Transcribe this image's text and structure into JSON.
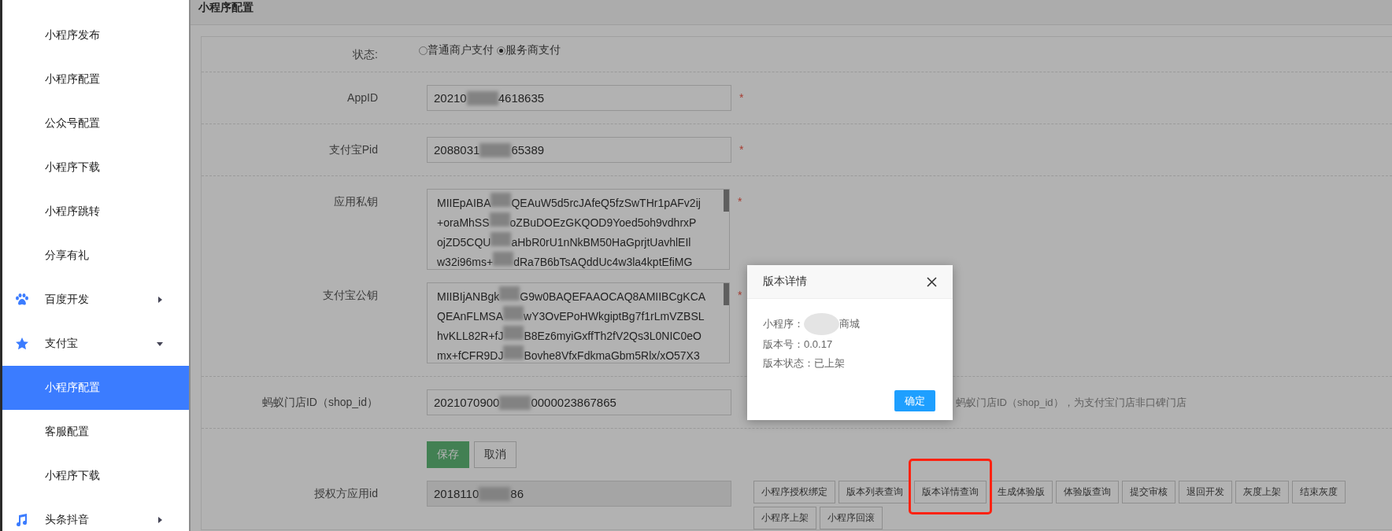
{
  "sidebar": {
    "items": [
      {
        "label": "小程序发布",
        "kind": "sub",
        "selected": false
      },
      {
        "label": "小程序配置",
        "kind": "sub",
        "selected": false
      },
      {
        "label": "公众号配置",
        "kind": "sub",
        "selected": false
      },
      {
        "label": "小程序下载",
        "kind": "sub",
        "selected": false
      },
      {
        "label": "小程序跳转",
        "kind": "sub",
        "selected": false
      },
      {
        "label": "分享有礼",
        "kind": "sub",
        "selected": false
      },
      {
        "label": "百度开发",
        "kind": "group",
        "expanded": false
      },
      {
        "label": "支付宝",
        "kind": "group",
        "expanded": true
      },
      {
        "label": "小程序配置",
        "kind": "sub",
        "selected": true
      },
      {
        "label": "客服配置",
        "kind": "sub",
        "selected": false
      },
      {
        "label": "小程序下载",
        "kind": "sub",
        "selected": false
      },
      {
        "label": "头条抖音",
        "kind": "group",
        "expanded": false
      }
    ]
  },
  "page_title": "小程序配置",
  "form": {
    "rows": [
      {
        "kind": "radio",
        "label": "状态:",
        "options": [
          {
            "label": "普通商户支付",
            "selected": false
          },
          {
            "label": "服务商支付",
            "selected": true
          }
        ]
      },
      {
        "kind": "input",
        "label": "AppID",
        "value_parts": [
          "20210",
          "4618635"
        ],
        "required_mark": "*"
      },
      {
        "kind": "input",
        "label": "支付宝Pid",
        "value_parts": [
          "2088031",
          "65389"
        ],
        "required_mark": "*"
      },
      {
        "kind": "textarea",
        "label": "应用私钥",
        "required_mark": "*",
        "lines": [
          [
            "MIIEpAIBA",
            "QEAuW5d5rcJAfeQ5fzSwTHr1pAFv2ij"
          ],
          [
            "+oraMhSS",
            "oZBuDOEzGKQOD9Yoed5oh9vdhrxP"
          ],
          [
            "ojZD5CQU",
            "aHbR0rU1nNkBM50HaGprjtUavhlEIl"
          ],
          [
            "w32i96ms+",
            "dRa7B6bTsAQddUc4w3la4kptEfiMG"
          ]
        ]
      },
      {
        "kind": "textarea",
        "label": "支付宝公钥",
        "required_mark": "*",
        "lines": [
          [
            "MIIBIjANBgk",
            "G9w0BAQEFAAOCAQ8AMIIBCgKCA"
          ],
          [
            "QEAnFLMSA",
            "wY3OvEPoHWkgiptBg7f1rLmVZBSL"
          ],
          [
            "hvKLL82R+fJ",
            "B8Ez6myiGxffTh2fV2Qs3L0NIC0eO"
          ],
          [
            "mx+fCFR9DJ",
            "Bovhe8VfxFdkmaGbm5Rlx/xO57X3"
          ]
        ]
      },
      {
        "kind": "input",
        "label": "蚂蚁门店ID（shop_id）",
        "value_parts": [
          "2021070900",
          "0000023867865"
        ],
        "hint": "蚂蚁门店ID（shop_id），为支付宝门店非口碑门店"
      },
      {
        "kind": "actions",
        "buttons": [
          {
            "label": "保存",
            "kind": "primary"
          },
          {
            "label": "取消",
            "kind": "default"
          }
        ]
      },
      {
        "kind": "input",
        "label": "授权方应用id",
        "value_parts": [
          "2018110",
          "86"
        ],
        "disabled": true,
        "buttons": [
          {
            "label": "小程序授权绑定",
            "highlighted": false
          },
          {
            "label": "版本列表查询",
            "highlighted": false
          },
          {
            "label": "版本详情查询",
            "highlighted": true
          },
          {
            "label": "生成体验版",
            "highlighted": false
          },
          {
            "label": "体验版查询",
            "highlighted": false
          },
          {
            "label": "提交审核",
            "highlighted": false
          },
          {
            "label": "退回开发",
            "highlighted": false
          },
          {
            "label": "灰度上架",
            "highlighted": false
          },
          {
            "label": "结束灰度",
            "highlighted": false
          },
          {
            "label": "小程序上架",
            "highlighted": false
          },
          {
            "label": "小程序回滚",
            "highlighted": false
          }
        ]
      }
    ]
  },
  "dialog": {
    "title": "版本详情",
    "lines": [
      {
        "label": "小程序：",
        "value": "商城",
        "redacted": true
      },
      {
        "label": "版本号：",
        "value": "0.0.17"
      },
      {
        "label": "版本状态：",
        "value": "已上架"
      }
    ],
    "confirm": "确定"
  }
}
